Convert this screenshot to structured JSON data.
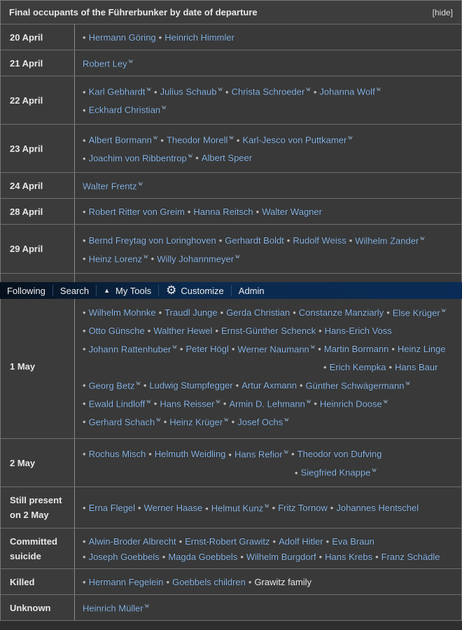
{
  "title": "Final occupants of the Führerbunker by date of departure",
  "hide_label": "[hide]",
  "toolbar": {
    "following": "Following",
    "search": "Search",
    "mytools": "My Tools",
    "customize": "Customize",
    "admin": "Admin"
  },
  "rows": [
    {
      "label": "20 April",
      "lines": [
        [
          {
            "t": "Hermann Göring",
            "b": 1
          },
          {
            "t": "Heinrich Himmler",
            "b": 1
          }
        ]
      ]
    },
    {
      "label": "21 April",
      "lines": [
        [
          {
            "t": "Robert Ley",
            "w": 1
          }
        ]
      ]
    },
    {
      "label": "22 April",
      "lines": [
        [
          {
            "t": "Karl Gebhardt",
            "b": 1,
            "w": 1
          },
          {
            "t": "Julius Schaub",
            "b": 1,
            "w": 1
          },
          {
            "t": "Christa Schroeder",
            "b": 1,
            "w": 1
          },
          {
            "t": "Johanna Wolf",
            "b": 1,
            "w": 1
          }
        ],
        [
          {
            "t": "Eckhard Christian",
            "b": 1,
            "w": 1
          }
        ]
      ]
    },
    {
      "label": "23 April",
      "lines": [
        [
          {
            "t": "Albert Bormann",
            "b": 1,
            "w": 1
          },
          {
            "t": "Theodor Morell",
            "b": 1,
            "w": 1
          },
          {
            "t": "Karl-Jesco von Puttkamer",
            "b": 1,
            "w": 1
          }
        ],
        [
          {
            "t": "Joachim von Ribbentrop",
            "b": 1,
            "w": 1
          },
          {
            "t": "Albert Speer",
            "b": 1
          }
        ]
      ]
    },
    {
      "label": "24 April",
      "lines": [
        [
          {
            "t": "Walter Frentz",
            "w": 1
          }
        ]
      ]
    },
    {
      "label": "28 April",
      "lines": [
        [
          {
            "t": "Robert Ritter von Greim",
            "b": 1
          },
          {
            "t": "Hanna Reitsch",
            "b": 1
          },
          {
            "t": "Walter Wagner",
            "b": 1
          }
        ]
      ]
    },
    {
      "label": "29 April",
      "lines": [
        [
          {
            "t": "Bernd Freytag von Loringhoven",
            "b": 1
          },
          {
            "t": "Gerhardt Boldt",
            "b": 1
          },
          {
            "t": "Rudolf Weiss",
            "b": 1
          },
          {
            "t": "Wilhelm Zander",
            "b": 1,
            "w": 1
          }
        ],
        [
          {
            "t": "Heinz Lorenz",
            "b": 1,
            "w": 1
          },
          {
            "t": "Willy Johannmeyer",
            "b": 1,
            "w": 1
          }
        ]
      ]
    },
    {
      "label": "",
      "lines": []
    },
    {
      "label": "1 May",
      "lines": [
        [
          {
            "t": "Wilhelm Mohnke",
            "b": 1
          },
          {
            "t": "Traudl Junge",
            "b": 1
          },
          {
            "t": "Gerda Christian",
            "b": 1
          },
          {
            "t": "Constanze Manziarly",
            "b": 1
          },
          {
            "t": "Else Krüger",
            "b": 1,
            "w": 1
          }
        ],
        [
          {
            "t": "Otto Günsche",
            "b": 1
          },
          {
            "t": "Walther Hewel",
            "b": 1
          },
          {
            "t": "Ernst-Günther Schenck",
            "b": 1
          },
          {
            "t": "Hans-Erich Voss",
            "b": 1
          }
        ],
        [
          {
            "t": "Johann Rattenhuber",
            "b": 1,
            "w": 1
          },
          {
            "t": "Peter Högl",
            "b": 1
          },
          {
            "t": "Werner Naumann",
            "b": 1,
            "w": 1
          },
          {
            "t": "Martin Bormann",
            "b": 1
          },
          {
            "t": "Heinz Linge",
            "b": 1
          }
        ],
        [
          {
            "t": "Erich Kempka",
            "b": 1
          },
          {
            "t": "Hans Baur",
            "b": 1
          }
        ],
        [
          {
            "t": "Georg Betz",
            "b": 1,
            "w": 1
          },
          {
            "t": "Ludwig Stumpfegger",
            "b": 1
          },
          {
            "t": "Artur Axmann",
            "b": 1
          },
          {
            "t": "Günther Schwägermann",
            "b": 1,
            "w": 1
          }
        ],
        [
          {
            "t": "Ewald Lindloff",
            "b": 1,
            "w": 1
          },
          {
            "t": "Hans Reisser",
            "b": 1,
            "w": 1
          },
          {
            "t": "Armin D. Lehmann",
            "b": 1,
            "w": 1
          },
          {
            "t": "Heinrich Doose",
            "b": 1,
            "w": 1
          }
        ],
        [
          {
            "t": "Gerhard Schach",
            "b": 1,
            "w": 1
          },
          {
            "t": "Heinz Krüger",
            "b": 1,
            "w": 1
          },
          {
            "t": "Josef Ochs",
            "b": 1,
            "w": 1
          }
        ]
      ]
    },
    {
      "label": "2 May",
      "lines": [
        [
          {
            "t": "Rochus Misch",
            "b": 1
          },
          {
            "t": "Helmuth Weidling",
            "b": 1
          },
          {
            "t": "Hans Refior",
            "b": 1,
            "w": 1
          },
          {
            "t": "Theodor von Dufving",
            "b": 1
          }
        ],
        [
          {
            "t": "Siegfried Knappe",
            "b": 1,
            "w": 1
          }
        ]
      ]
    },
    {
      "label": "Still present on 2 May",
      "lines": [
        [
          {
            "t": "Erna Flegel",
            "b": 1
          },
          {
            "t": "Werner Haase",
            "b": 1
          },
          {
            "t": "Helmut Kunz",
            "b": 1,
            "w": 1
          },
          {
            "t": "Fritz Tornow",
            "b": 1
          },
          {
            "t": "Johannes Hentschel",
            "b": 1
          }
        ]
      ]
    },
    {
      "label": "Committed suicide",
      "lines": [
        [
          {
            "t": "Alwin-Broder Albrecht",
            "b": 1
          },
          {
            "t": "Ernst-Robert Grawitz",
            "b": 1
          },
          {
            "t": "Adolf Hitler",
            "b": 1
          },
          {
            "t": "Eva Braun",
            "b": 1
          }
        ],
        [
          {
            "t": "Joseph Goebbels",
            "b": 1
          },
          {
            "t": "Magda Goebbels",
            "b": 1
          },
          {
            "t": "Wilhelm Burgdorf",
            "b": 1
          },
          {
            "t": "Hans Krebs",
            "b": 1
          },
          {
            "t": "Franz Schädle",
            "b": 1
          }
        ]
      ]
    },
    {
      "label": "Killed",
      "lines": [
        [
          {
            "t": "Hermann Fegelein",
            "b": 1
          },
          {
            "t": "Goebbels children",
            "b": 1
          },
          {
            "t": "Grawitz family",
            "b": 1,
            "plain": 1
          }
        ]
      ]
    },
    {
      "label": "Unknown",
      "lines": [
        [
          {
            "t": "Heinrich Müller",
            "w": 1
          }
        ]
      ]
    }
  ]
}
